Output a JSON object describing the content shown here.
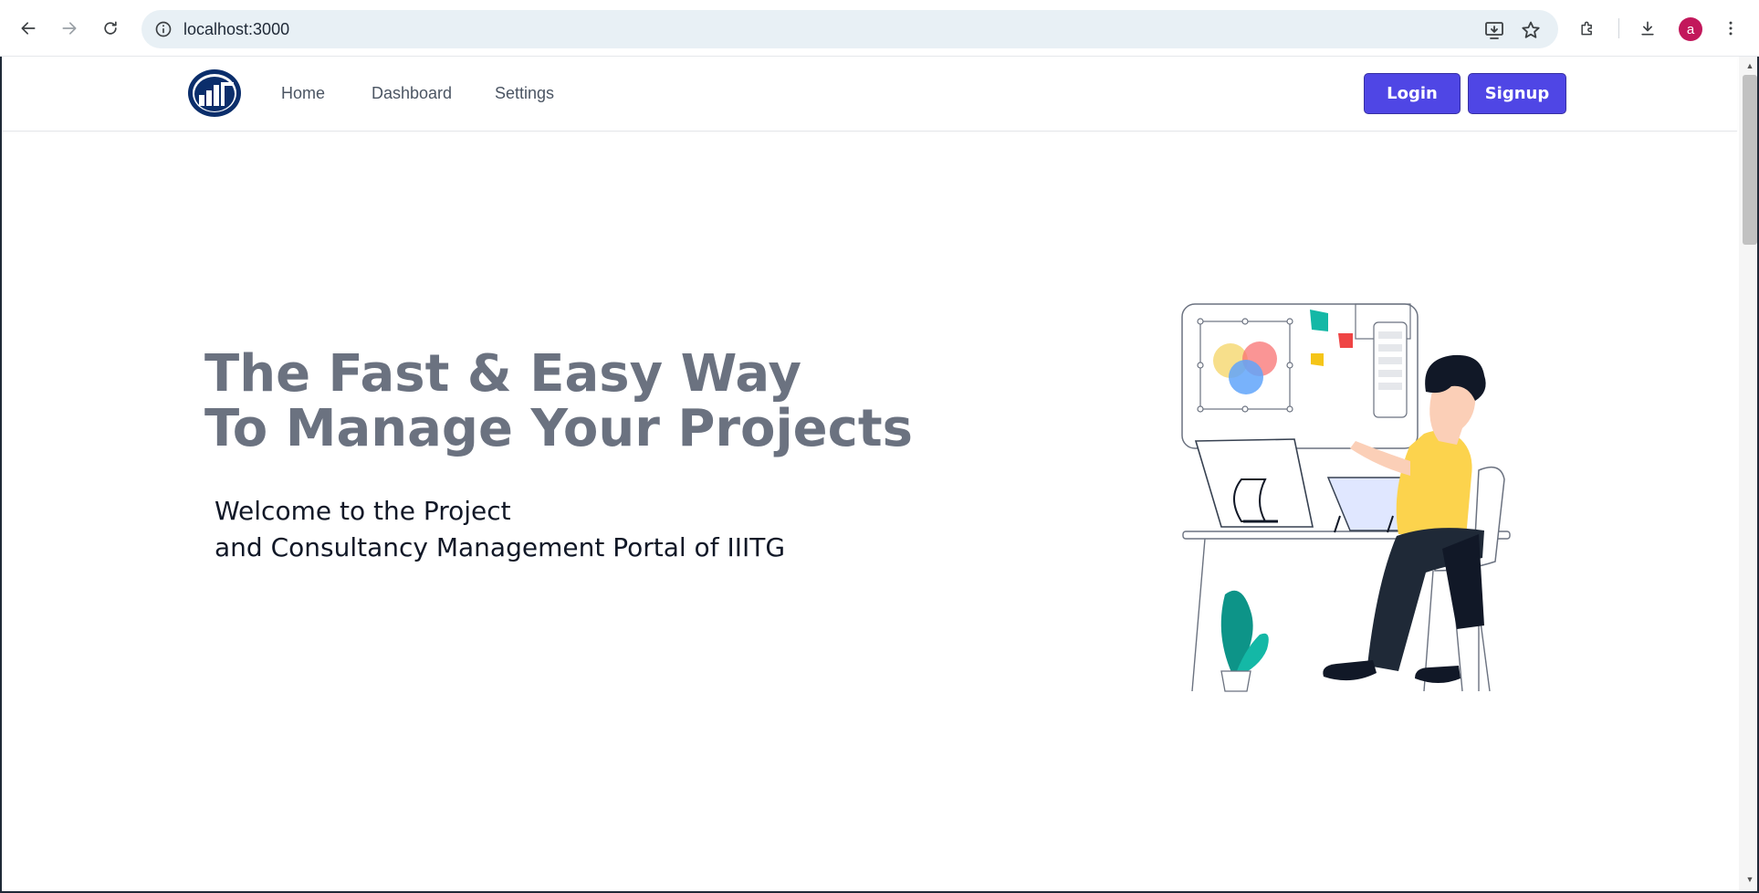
{
  "browser": {
    "url": "localhost:3000",
    "profile_initial": "a",
    "profile_color": "#c2185b"
  },
  "nav": {
    "links": [
      "Home",
      "Dashboard",
      "Settings"
    ],
    "login_label": "Login",
    "signup_label": "Signup",
    "accent_color": "#4f46e5"
  },
  "hero": {
    "title_line1": "The Fast & Easy Way",
    "title_line2": "To Manage Your Projects",
    "subtitle_line1": "Welcome to the Project",
    "subtitle_line2": "and Consultancy Management Portal of IIITG"
  },
  "icons": [
    "back-arrow-icon",
    "forward-arrow-icon",
    "reload-icon",
    "info-icon",
    "install-app-icon",
    "star-icon",
    "extensions-icon",
    "download-icon",
    "more-vert-icon",
    "logo-icon"
  ]
}
